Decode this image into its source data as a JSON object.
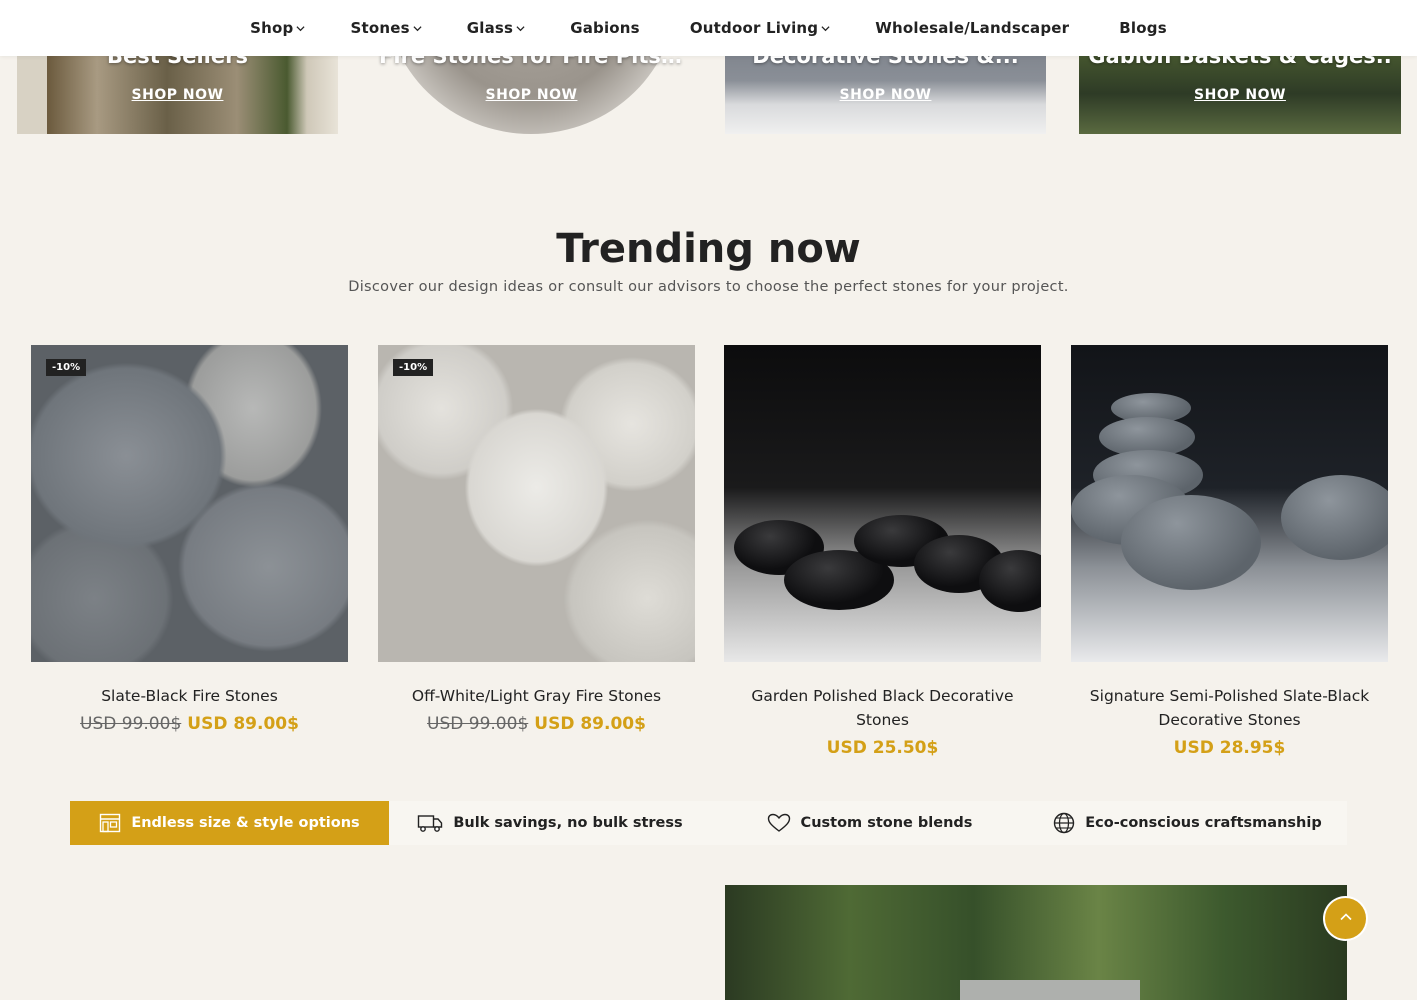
{
  "nav": {
    "items": [
      {
        "label": "Shop",
        "has_dropdown": true
      },
      {
        "label": "Stones",
        "has_dropdown": true
      },
      {
        "label": "Glass",
        "has_dropdown": true
      },
      {
        "label": "Gabions",
        "has_dropdown": false
      },
      {
        "label": "Outdoor Living",
        "has_dropdown": true
      },
      {
        "label": "Wholesale/Landscaper",
        "has_dropdown": false
      },
      {
        "label": "Blogs",
        "has_dropdown": false
      }
    ]
  },
  "categories": [
    {
      "title": "Best Sellers",
      "cta": "SHOP NOW"
    },
    {
      "title": "Fire Stones for Fire Pits ...",
      "cta": "SHOP NOW"
    },
    {
      "title": "Decorative Stones &...",
      "cta": "SHOP NOW"
    },
    {
      "title": "Gabion Baskets & Cages..",
      "cta": "SHOP NOW"
    }
  ],
  "trending": {
    "title": "Trending now",
    "subtitle": "Discover our design ideas or consult our advisors to choose the perfect stones for your project."
  },
  "products": [
    {
      "name": "Slate-Black Fire Stones",
      "badge": "-10%",
      "old_price": "USD 99.00$",
      "price": "USD 89.00$"
    },
    {
      "name": "Off-White/Light Gray Fire Stones",
      "badge": "-10%",
      "old_price": "USD 99.00$",
      "price": "USD 89.00$"
    },
    {
      "name": "Garden Polished Black Decorative Stones",
      "badge": "",
      "old_price": "",
      "price": "USD 25.50$"
    },
    {
      "name": "Signature Semi-Polished Slate-Black Decorative Stones",
      "badge": "",
      "old_price": "",
      "price": "USD 28.95$"
    }
  ],
  "features": [
    {
      "label": "Endless size & style options",
      "icon": "storefront-icon",
      "active": true
    },
    {
      "label": "Bulk savings, no bulk stress",
      "icon": "truck-icon",
      "active": false
    },
    {
      "label": "Custom stone blends",
      "icon": "heart-icon",
      "active": false
    },
    {
      "label": "Eco-conscious craftsmanship",
      "icon": "globe-icon",
      "active": false
    }
  ],
  "colors": {
    "accent": "#d4a017",
    "background": "#f5f2ec",
    "text": "#222222"
  },
  "scroll_top": {
    "icon": "chevron-up-icon"
  }
}
